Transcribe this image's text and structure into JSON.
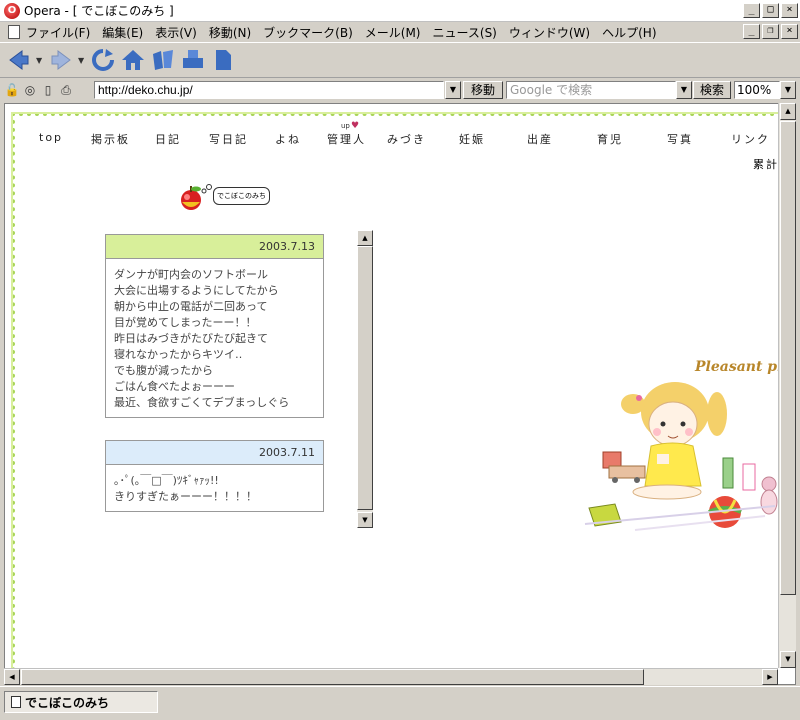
{
  "window": {
    "title": "Opera - [ でこぼこのみち ]",
    "controls": [
      "_",
      "□",
      "×"
    ],
    "mdi_controls": [
      "_",
      "❐",
      "×"
    ]
  },
  "menu": [
    "ファイル(F)",
    "編集(E)",
    "表示(V)",
    "移動(N)",
    "ブックマーク(B)",
    "メール(M)",
    "ニュース(S)",
    "ウィンドウ(W)",
    "ヘルプ(H)"
  ],
  "toolbar": {
    "icons": [
      "back-icon",
      "forward-icon",
      "reload-icon",
      "home-icon",
      "hotlist-icon",
      "print-icon",
      "page-icon"
    ]
  },
  "address": {
    "url": "http://deko.chu.jp/",
    "go_label": "移動",
    "search_placeholder": "Google で検索",
    "search_label": "検索",
    "zoom": "100%"
  },
  "site": {
    "nav": [
      "top",
      "掲示板",
      "日記",
      "写日記",
      "よね",
      "管理人",
      "みづき",
      "妊娠",
      "出産",
      "育児",
      "写真",
      "リンク"
    ],
    "up_mark": "up",
    "counter_label": "累計",
    "logo_text": "でこぼこのみち",
    "illustration_caption": "Pleasant play"
  },
  "entries": [
    {
      "date": "2003.7.13",
      "lines": [
        "ダンナが町内会のソフトボール",
        "大会に出場するようにしてたから",
        "朝から中止の電話が二回あって",
        "目が覚めてしまったーー！！",
        "昨日はみづきがたびたび起きて",
        "寝れなかったからキツイ‥",
        "でも腹が減ったから",
        "ごはん食べたよぉーーー",
        "最近、食欲すごくてデブまっしぐら"
      ]
    },
    {
      "date": "2003.7.11",
      "lines": [
        "｡･ﾟ(｡￣□￣)ﾂｷﾞｬｧｯ!!",
        "きりすぎたぁーーー！！！！"
      ]
    }
  ],
  "status": {
    "tab_title": "でこぼこのみち"
  },
  "colors": {
    "entry1_header": "#d8ef9a",
    "entry2_header": "#dcecfa",
    "frame_dots": "#a8d458"
  }
}
